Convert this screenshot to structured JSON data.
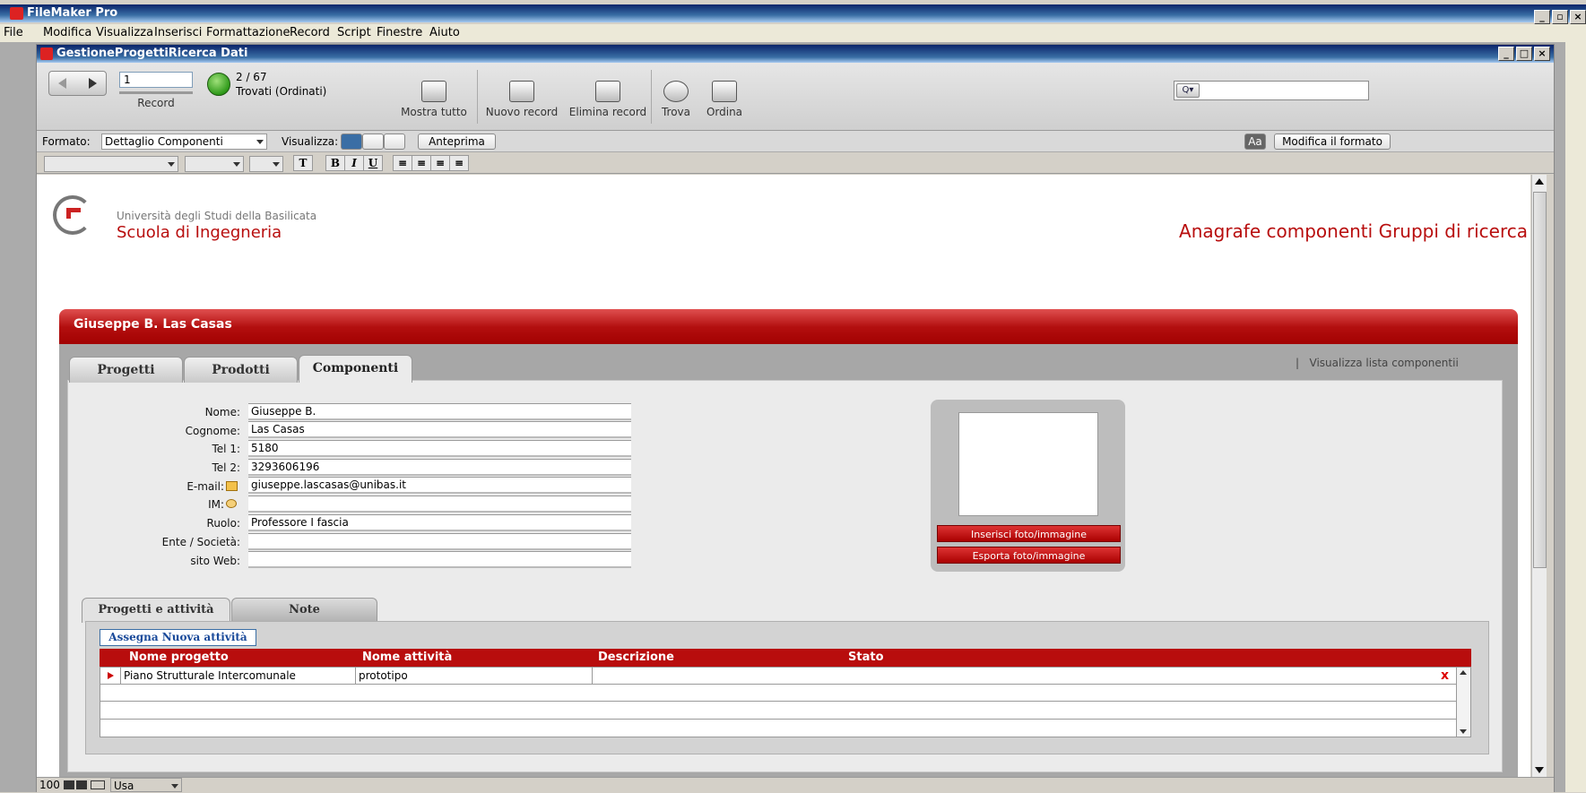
{
  "app": {
    "title": "FileMaker Pro"
  },
  "menu": [
    "File",
    "Modifica",
    "Visualizza",
    "Inserisci",
    "Formattazione",
    "Record",
    "Script",
    "Finestre",
    "Aiuto"
  ],
  "window": {
    "title": "GestioneProgettiRicerca Dati"
  },
  "toolbar": {
    "record_value": "1",
    "record_label": "Record",
    "count": "2 / 67",
    "found": "Trovati (Ordinati)",
    "show_all": "Mostra tutto",
    "new_record": "Nuovo record",
    "delete_record": "Elimina record",
    "find": "Trova",
    "sort": "Ordina"
  },
  "formatbar": {
    "format_label": "Formato:",
    "format_value": "Dettaglio Componenti",
    "view_label": "Visualizza:",
    "preview": "Anteprima",
    "edit_layout": "Modifica il formato"
  },
  "header": {
    "university": "Università degli Studi della Basilicata",
    "school": "Scuola di Ingegneria",
    "page_title": "Anagrafe componenti Gruppi di ricerca"
  },
  "person": {
    "name": "Giuseppe B. Las Casas"
  },
  "tabs": [
    "Progetti",
    "Prodotti",
    "Componenti"
  ],
  "active_tab": "Componenti",
  "view_list_link": "Visualizza lista componentii",
  "fields": [
    {
      "label": "Nome:",
      "value": "Giuseppe B."
    },
    {
      "label": "Cognome:",
      "value": "Las Casas"
    },
    {
      "label": "Tel 1:",
      "value": "5180"
    },
    {
      "label": "Tel 2:",
      "value": "3293606196"
    },
    {
      "label": "E-mail:",
      "value": "giuseppe.lascasas@unibas.it"
    },
    {
      "label": "IM:",
      "value": ""
    },
    {
      "label": "Ruolo:",
      "value": "Professore I fascia"
    },
    {
      "label": "Ente / Società:",
      "value": ""
    },
    {
      "label": "sito Web:",
      "value": ""
    }
  ],
  "photo": {
    "insert": "Inserisci foto/immagine",
    "export": "Esporta foto/immagine"
  },
  "subtabs": [
    "Progetti e attività",
    "Note"
  ],
  "assign_button": "Assegna Nuova attività",
  "portal": {
    "headers": [
      "Nome progetto",
      "Nome attività",
      "Descrizione",
      "Stato"
    ],
    "rows": [
      {
        "project": "Piano Strutturale Intercomunale",
        "activity": "prototipo",
        "description": "",
        "status": ""
      }
    ],
    "delete_mark": "x"
  },
  "status": {
    "zoom": "100",
    "mode": "Usa"
  },
  "colors": {
    "accent": "#b80d0d",
    "title_red": "#b80d0d"
  }
}
